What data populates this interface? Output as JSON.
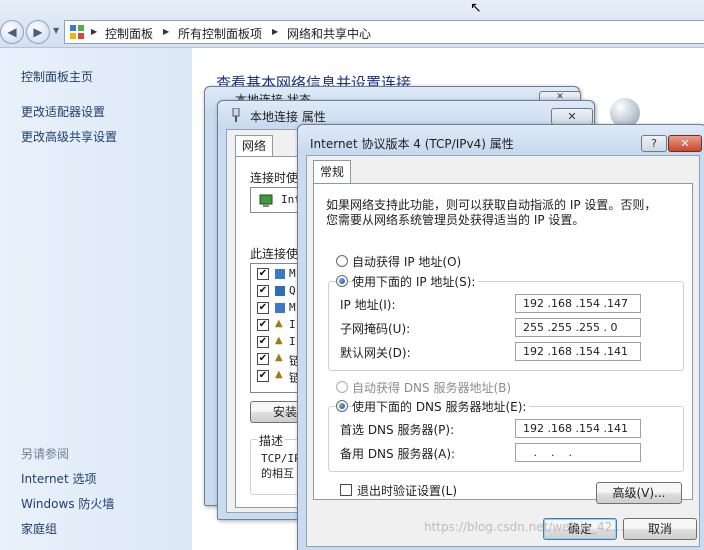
{
  "explorer": {
    "breadcrumbs": [
      "控制面板",
      "所有控制面板项",
      "网络和共享中心"
    ],
    "main_title": "查看基本网络信息并设置连接",
    "sidebar": {
      "top_links": [
        "控制面板主页",
        "更改适配器设置",
        "更改高级共享设置"
      ],
      "see_also_header": "另请参阅",
      "see_also_links": [
        "Internet 选项",
        "Windows 防火墙",
        "家庭组"
      ]
    }
  },
  "status_window": {
    "title": "本地连接 状态"
  },
  "local_props": {
    "title": "本地连接 属性",
    "tab": "网络",
    "connect_using_label": "连接时使",
    "adapter_text": "Inte",
    "items_label": "此连接使",
    "items": [
      {
        "checked": true,
        "text": "M"
      },
      {
        "checked": true,
        "text": "Q"
      },
      {
        "checked": true,
        "text": "M"
      },
      {
        "checked": true,
        "text": "I"
      },
      {
        "checked": true,
        "text": "I"
      },
      {
        "checked": true,
        "text": "链"
      },
      {
        "checked": true,
        "text": "链"
      }
    ],
    "install_button": "安装",
    "description_label": "描述",
    "description_text": [
      "TCP/IP",
      "的相互"
    ]
  },
  "ipv4": {
    "title": "Internet 协议版本 4 (TCP/IPv4) 属性",
    "help_glyph": "?",
    "close_glyph": "✕",
    "tab": "常规",
    "intro_line1": "如果网络支持此功能，则可以获取自动指派的 IP 设置。否则，",
    "intro_line2": "您需要从网络系统管理员处获得适当的 IP 设置。",
    "radio_auto_ip": "自动获得 IP 地址(O)",
    "radio_manual_ip": "使用下面的 IP 地址(S):",
    "ip_label": "IP 地址(I):",
    "ip_value": "192 .168 .154 .147",
    "mask_label": "子网掩码(U):",
    "mask_value": "255 .255 .255 . 0",
    "gateway_label": "默认网关(D):",
    "gateway_value": "192 .168 .154 .141",
    "radio_auto_dns": "自动获得 DNS 服务器地址(B)",
    "radio_manual_dns": "使用下面的 DNS 服务器地址(E):",
    "dns1_label": "首选 DNS 服务器(P):",
    "dns1_value": "192 .168 .154 .141",
    "dns2_label": "备用 DNS 服务器(A):",
    "dns2_value": "   .    .    .   ",
    "validate_label": "退出时验证设置(L)",
    "validate_checked": false,
    "advanced_button": "高级(V)...",
    "ok_button": "确定",
    "cancel_button": "取消",
    "watermark": "https://blog.csdn.net/weixin_42..."
  },
  "colors": {
    "sidebar_link": "#1e3e6c",
    "title_blue": "#1e3287",
    "close_red": "#c9452c"
  }
}
